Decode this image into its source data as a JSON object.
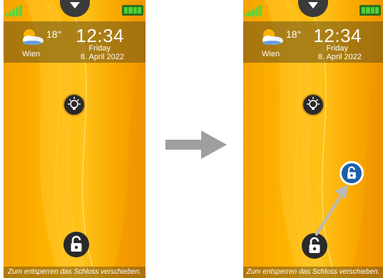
{
  "screen": {
    "status": {
      "signal_icon": "signal-bars-icon",
      "battery_icon": "battery-full-icon",
      "notch_icon": "chevron-down-icon"
    },
    "weather": {
      "temperature": "18°",
      "city": "Wien",
      "icon": "partly-cloudy-icon"
    },
    "clock": {
      "time": "12:34",
      "day": "Friday",
      "date": "8. April 2022"
    },
    "flashlight_icon": "lightbulb-icon",
    "lock_icon": "padlock-icon",
    "hint": "Zum entsperren das Schloss verschieben."
  },
  "transition_arrow_icon": "right-arrow-icon",
  "colors": {
    "background": "#ffb300",
    "panel": "#785a19",
    "lock_active": "#1d5fa8",
    "battery": "#4cd137"
  }
}
